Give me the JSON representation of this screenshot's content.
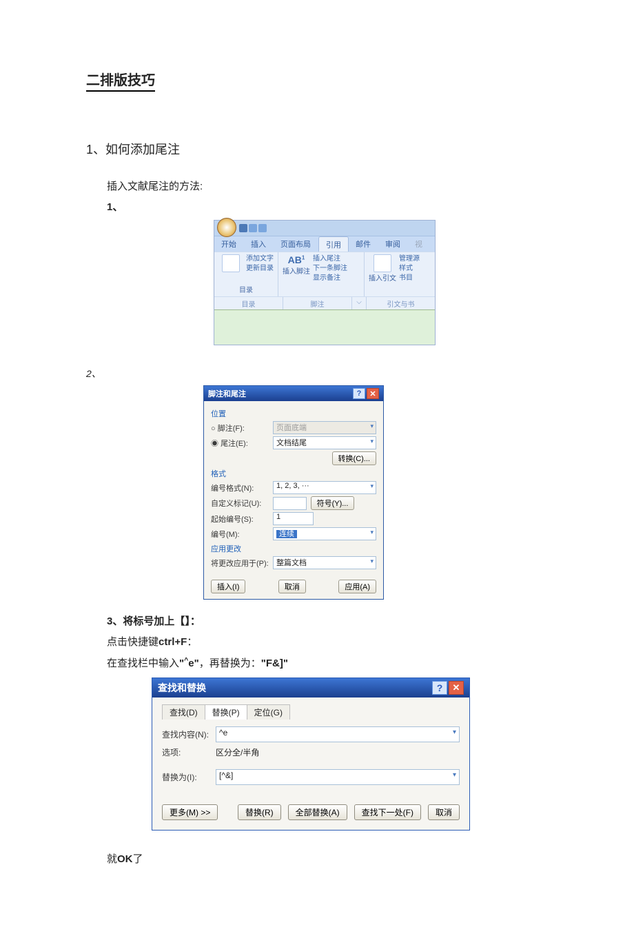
{
  "title": "二排版技巧",
  "section": "1、如何添加尾注",
  "intro": "插入文献尾注的方法:",
  "step1": "1、",
  "ribbon": {
    "tabs": [
      "开始",
      "插入",
      "页面布局",
      "引用",
      "邮件",
      "审阅",
      "视"
    ],
    "grp_toc": {
      "add_text": "添加文字",
      "update": "更新目录",
      "label": "目录"
    },
    "grp_fn": {
      "ab": "AB",
      "insert_fn": "插入脚注",
      "insert_en": "插入尾注",
      "next_fn": "下一条脚注",
      "show": "显示备注",
      "label": "脚注"
    },
    "grp_cite": {
      "insert": "插入引文",
      "manage": "管理源",
      "style": "样式",
      "biblio": "书目",
      "label": "引文与书"
    }
  },
  "step2": "2、",
  "dlg1": {
    "title": "脚注和尾注",
    "s_pos": "位置",
    "footnote": "脚注(F):",
    "footnote_v": "页面底端",
    "endnote": "尾注(E):",
    "endnote_v": "文档结尾",
    "convert": "转换(C)...",
    "s_fmt": "格式",
    "num_fmt": "编号格式(N):",
    "num_fmt_v": "1, 2, 3,  ···",
    "custom": "自定义标记(U):",
    "symbol": "符号(Y)...",
    "start": "起始编号(S):",
    "start_v": "1",
    "numbering": "编号(M):",
    "numbering_v": "连续",
    "s_apply": "应用更改",
    "apply_to": "将更改应用于(P):",
    "apply_to_v": "整篇文档",
    "insert": "插入(I)",
    "cancel": "取消",
    "apply": "应用(A)"
  },
  "step3": "3、将标号加上【】：",
  "hotkey_pre": "点击快捷键",
  "hotkey": "ctrl+F",
  "hotkey_post": "：",
  "find_line_pre": "在查找栏中输入",
  "find_token": "\"^e\"",
  "find_mid": "，再替换为：",
  "repl_token": "\"F&]\"",
  "dlg2": {
    "title": "查找和替换",
    "tabs": [
      "查找(D)",
      "替换(P)",
      "定位(G)"
    ],
    "find_lbl": "查找内容(N):",
    "find_v": "^e",
    "options_lbl": "选项:",
    "options_v": "区分全/半角",
    "repl_lbl": "替换为(I):",
    "repl_v": "[^&]",
    "more": "更多(M) >>",
    "replace": "替换(R)",
    "replace_all": "全部替换(A)",
    "find_next": "查找下一处(F)",
    "cancel": "取消"
  },
  "ok_line_pre": "就",
  "ok": "OK",
  "ok_line_post": "了"
}
